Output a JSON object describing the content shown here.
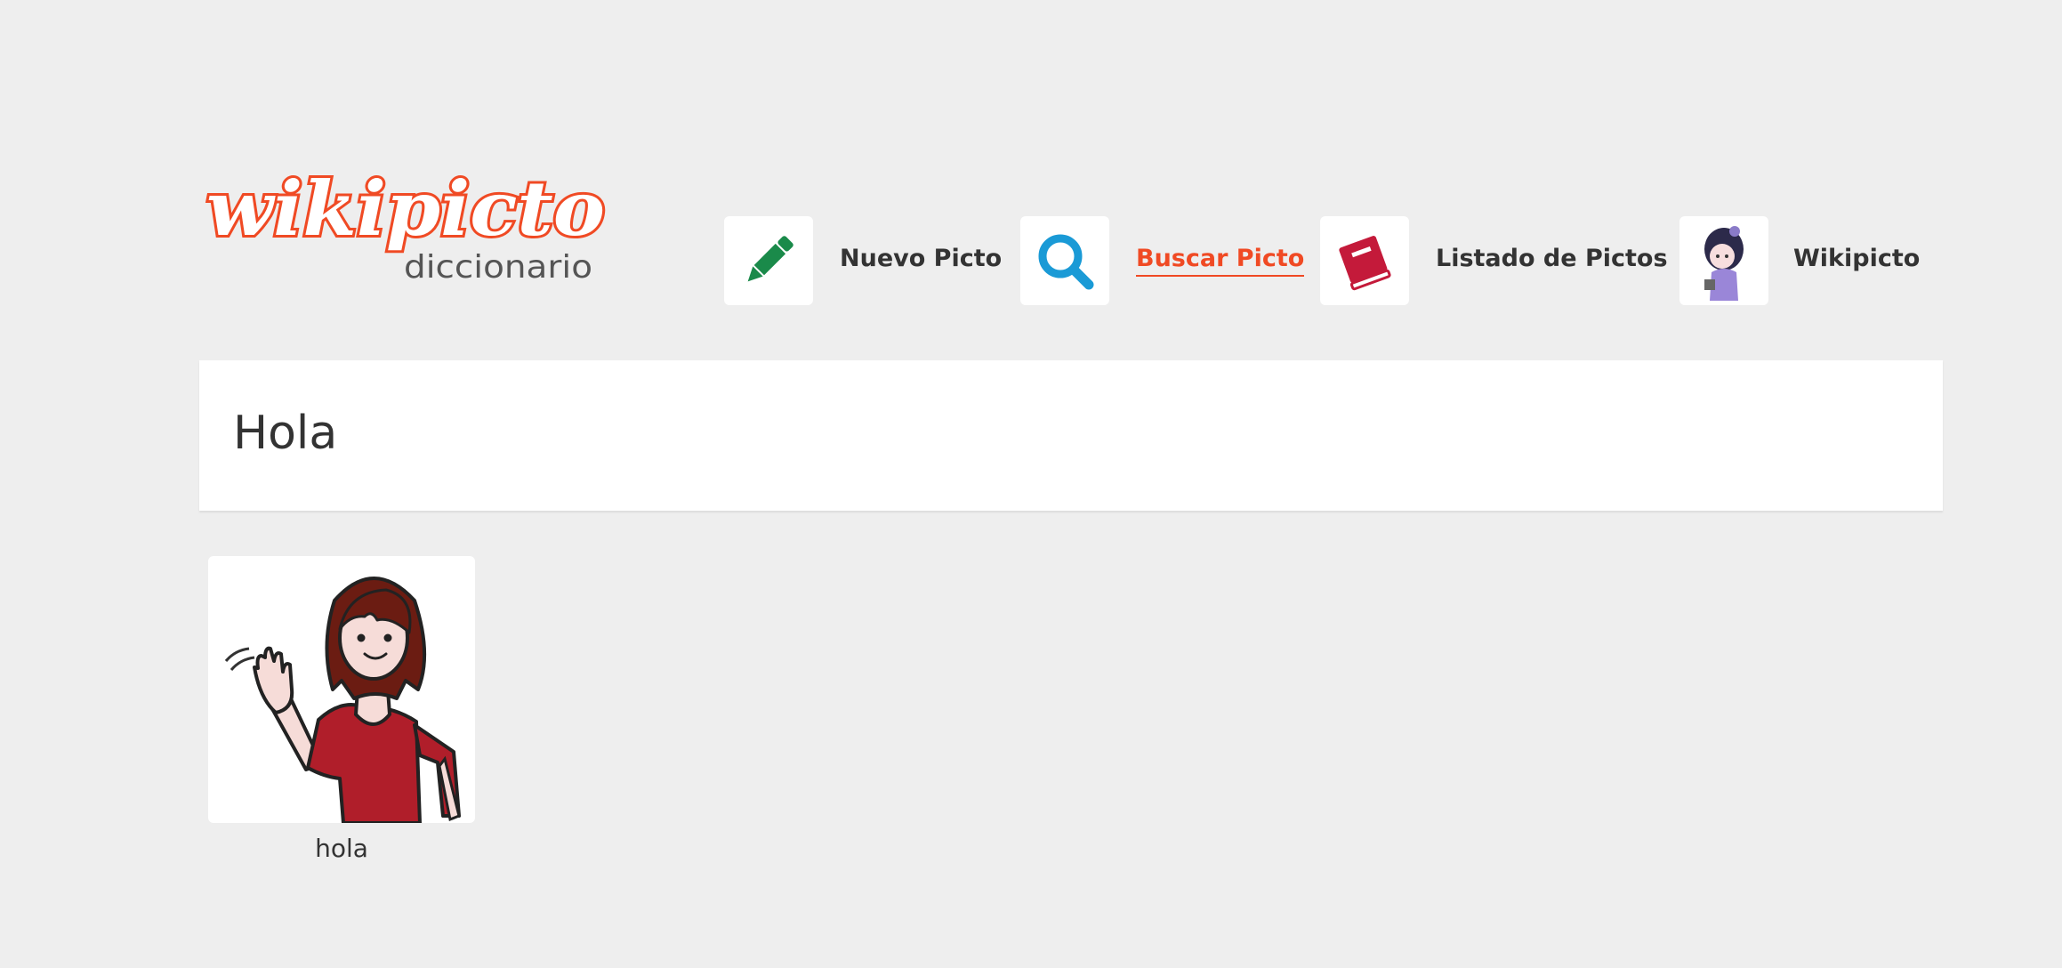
{
  "logo": {
    "wordmark": "wikipicto",
    "subtitle": "diccionario",
    "brand_color": "#f04a24",
    "subtitle_color": "#555555"
  },
  "nav": {
    "items": [
      {
        "label": "Nuevo Picto",
        "icon": "pencil-icon",
        "icon_color": "#1a8a4a",
        "active": false
      },
      {
        "label": "Buscar Picto",
        "icon": "search-icon",
        "icon_color": "#1a9ad6",
        "active": true
      },
      {
        "label": "Listado de Pictos",
        "icon": "book-icon",
        "icon_color": "#c41a3a",
        "active": false
      },
      {
        "label": "Wikipicto",
        "icon": "girl-avatar-icon",
        "active": false
      }
    ],
    "active_color": "#f04a24"
  },
  "search": {
    "title": "Hola"
  },
  "results": [
    {
      "label": "hola",
      "image": "girl-waving-pictogram"
    }
  ],
  "colors": {
    "background": "#eeeeee",
    "panel": "#ffffff",
    "text": "#333333"
  }
}
